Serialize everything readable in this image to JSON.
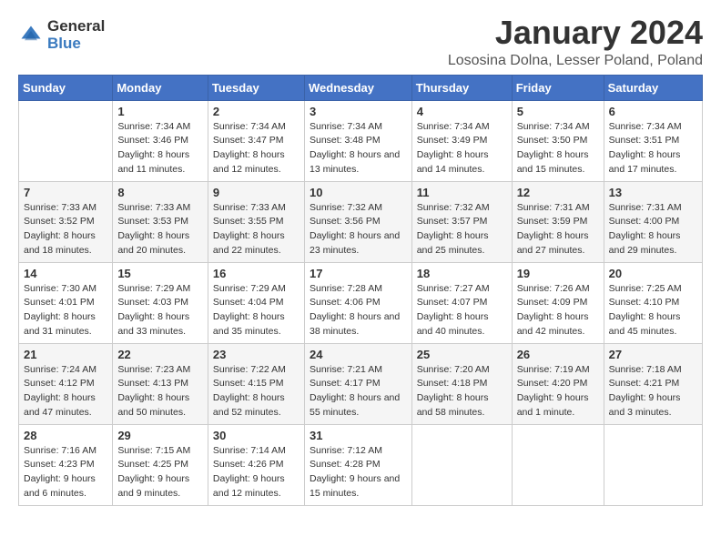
{
  "logo": {
    "general": "General",
    "blue": "Blue"
  },
  "title": "January 2024",
  "subtitle": "Lososina Dolna, Lesser Poland, Poland",
  "days_of_week": [
    "Sunday",
    "Monday",
    "Tuesday",
    "Wednesday",
    "Thursday",
    "Friday",
    "Saturday"
  ],
  "weeks": [
    [
      {
        "day": "",
        "sunrise": "",
        "sunset": "",
        "daylight": ""
      },
      {
        "day": "1",
        "sunrise": "Sunrise: 7:34 AM",
        "sunset": "Sunset: 3:46 PM",
        "daylight": "Daylight: 8 hours and 11 minutes."
      },
      {
        "day": "2",
        "sunrise": "Sunrise: 7:34 AM",
        "sunset": "Sunset: 3:47 PM",
        "daylight": "Daylight: 8 hours and 12 minutes."
      },
      {
        "day": "3",
        "sunrise": "Sunrise: 7:34 AM",
        "sunset": "Sunset: 3:48 PM",
        "daylight": "Daylight: 8 hours and 13 minutes."
      },
      {
        "day": "4",
        "sunrise": "Sunrise: 7:34 AM",
        "sunset": "Sunset: 3:49 PM",
        "daylight": "Daylight: 8 hours and 14 minutes."
      },
      {
        "day": "5",
        "sunrise": "Sunrise: 7:34 AM",
        "sunset": "Sunset: 3:50 PM",
        "daylight": "Daylight: 8 hours and 15 minutes."
      },
      {
        "day": "6",
        "sunrise": "Sunrise: 7:34 AM",
        "sunset": "Sunset: 3:51 PM",
        "daylight": "Daylight: 8 hours and 17 minutes."
      }
    ],
    [
      {
        "day": "7",
        "sunrise": "Sunrise: 7:33 AM",
        "sunset": "Sunset: 3:52 PM",
        "daylight": "Daylight: 8 hours and 18 minutes."
      },
      {
        "day": "8",
        "sunrise": "Sunrise: 7:33 AM",
        "sunset": "Sunset: 3:53 PM",
        "daylight": "Daylight: 8 hours and 20 minutes."
      },
      {
        "day": "9",
        "sunrise": "Sunrise: 7:33 AM",
        "sunset": "Sunset: 3:55 PM",
        "daylight": "Daylight: 8 hours and 22 minutes."
      },
      {
        "day": "10",
        "sunrise": "Sunrise: 7:32 AM",
        "sunset": "Sunset: 3:56 PM",
        "daylight": "Daylight: 8 hours and 23 minutes."
      },
      {
        "day": "11",
        "sunrise": "Sunrise: 7:32 AM",
        "sunset": "Sunset: 3:57 PM",
        "daylight": "Daylight: 8 hours and 25 minutes."
      },
      {
        "day": "12",
        "sunrise": "Sunrise: 7:31 AM",
        "sunset": "Sunset: 3:59 PM",
        "daylight": "Daylight: 8 hours and 27 minutes."
      },
      {
        "day": "13",
        "sunrise": "Sunrise: 7:31 AM",
        "sunset": "Sunset: 4:00 PM",
        "daylight": "Daylight: 8 hours and 29 minutes."
      }
    ],
    [
      {
        "day": "14",
        "sunrise": "Sunrise: 7:30 AM",
        "sunset": "Sunset: 4:01 PM",
        "daylight": "Daylight: 8 hours and 31 minutes."
      },
      {
        "day": "15",
        "sunrise": "Sunrise: 7:29 AM",
        "sunset": "Sunset: 4:03 PM",
        "daylight": "Daylight: 8 hours and 33 minutes."
      },
      {
        "day": "16",
        "sunrise": "Sunrise: 7:29 AM",
        "sunset": "Sunset: 4:04 PM",
        "daylight": "Daylight: 8 hours and 35 minutes."
      },
      {
        "day": "17",
        "sunrise": "Sunrise: 7:28 AM",
        "sunset": "Sunset: 4:06 PM",
        "daylight": "Daylight: 8 hours and 38 minutes."
      },
      {
        "day": "18",
        "sunrise": "Sunrise: 7:27 AM",
        "sunset": "Sunset: 4:07 PM",
        "daylight": "Daylight: 8 hours and 40 minutes."
      },
      {
        "day": "19",
        "sunrise": "Sunrise: 7:26 AM",
        "sunset": "Sunset: 4:09 PM",
        "daylight": "Daylight: 8 hours and 42 minutes."
      },
      {
        "day": "20",
        "sunrise": "Sunrise: 7:25 AM",
        "sunset": "Sunset: 4:10 PM",
        "daylight": "Daylight: 8 hours and 45 minutes."
      }
    ],
    [
      {
        "day": "21",
        "sunrise": "Sunrise: 7:24 AM",
        "sunset": "Sunset: 4:12 PM",
        "daylight": "Daylight: 8 hours and 47 minutes."
      },
      {
        "day": "22",
        "sunrise": "Sunrise: 7:23 AM",
        "sunset": "Sunset: 4:13 PM",
        "daylight": "Daylight: 8 hours and 50 minutes."
      },
      {
        "day": "23",
        "sunrise": "Sunrise: 7:22 AM",
        "sunset": "Sunset: 4:15 PM",
        "daylight": "Daylight: 8 hours and 52 minutes."
      },
      {
        "day": "24",
        "sunrise": "Sunrise: 7:21 AM",
        "sunset": "Sunset: 4:17 PM",
        "daylight": "Daylight: 8 hours and 55 minutes."
      },
      {
        "day": "25",
        "sunrise": "Sunrise: 7:20 AM",
        "sunset": "Sunset: 4:18 PM",
        "daylight": "Daylight: 8 hours and 58 minutes."
      },
      {
        "day": "26",
        "sunrise": "Sunrise: 7:19 AM",
        "sunset": "Sunset: 4:20 PM",
        "daylight": "Daylight: 9 hours and 1 minute."
      },
      {
        "day": "27",
        "sunrise": "Sunrise: 7:18 AM",
        "sunset": "Sunset: 4:21 PM",
        "daylight": "Daylight: 9 hours and 3 minutes."
      }
    ],
    [
      {
        "day": "28",
        "sunrise": "Sunrise: 7:16 AM",
        "sunset": "Sunset: 4:23 PM",
        "daylight": "Daylight: 9 hours and 6 minutes."
      },
      {
        "day": "29",
        "sunrise": "Sunrise: 7:15 AM",
        "sunset": "Sunset: 4:25 PM",
        "daylight": "Daylight: 9 hours and 9 minutes."
      },
      {
        "day": "30",
        "sunrise": "Sunrise: 7:14 AM",
        "sunset": "Sunset: 4:26 PM",
        "daylight": "Daylight: 9 hours and 12 minutes."
      },
      {
        "day": "31",
        "sunrise": "Sunrise: 7:12 AM",
        "sunset": "Sunset: 4:28 PM",
        "daylight": "Daylight: 9 hours and 15 minutes."
      },
      {
        "day": "",
        "sunrise": "",
        "sunset": "",
        "daylight": ""
      },
      {
        "day": "",
        "sunrise": "",
        "sunset": "",
        "daylight": ""
      },
      {
        "day": "",
        "sunrise": "",
        "sunset": "",
        "daylight": ""
      }
    ]
  ]
}
